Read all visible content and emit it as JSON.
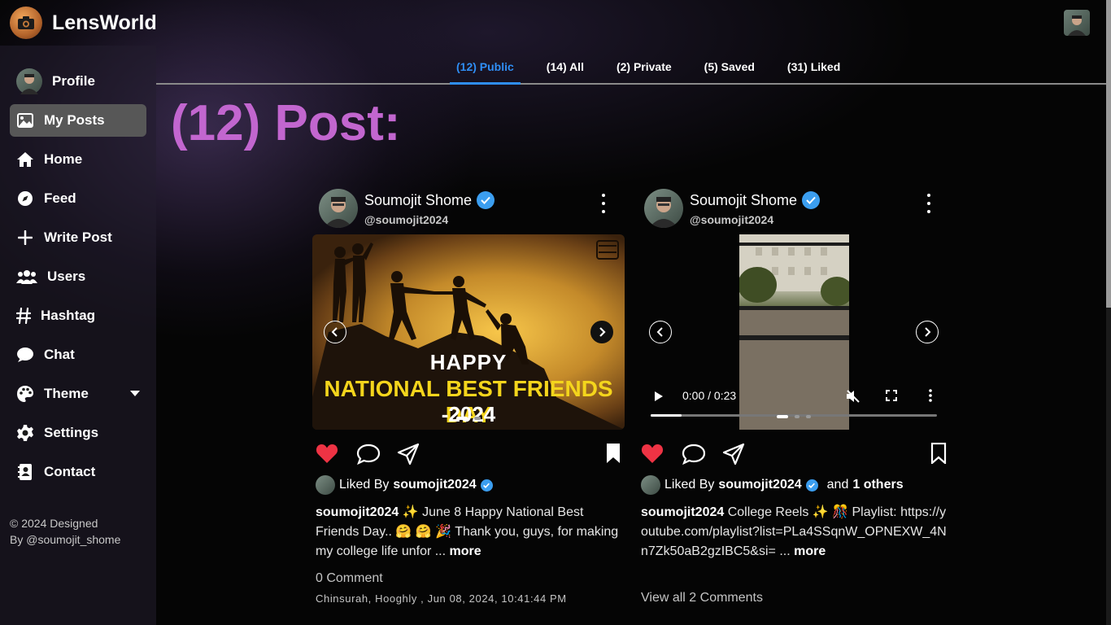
{
  "brand": {
    "name": "LensWorld"
  },
  "sidebar": {
    "items": [
      {
        "label": "Profile",
        "icon": "user-avatar"
      },
      {
        "label": "My Posts",
        "icon": "image-icon"
      },
      {
        "label": "Home",
        "icon": "home-icon"
      },
      {
        "label": "Feed",
        "icon": "compass-icon"
      },
      {
        "label": "Write Post",
        "icon": "plus-icon"
      },
      {
        "label": "Users",
        "icon": "users-icon"
      },
      {
        "label": "Hashtag",
        "icon": "hashtag-icon"
      },
      {
        "label": "Chat",
        "icon": "chat-icon"
      },
      {
        "label": "Theme",
        "icon": "palette-icon"
      },
      {
        "label": "Settings",
        "icon": "gear-icon"
      },
      {
        "label": "Contact",
        "icon": "contact-card-icon"
      }
    ],
    "footer_line1": "© 2024 Designed",
    "footer_line2": "By @soumojit_shome"
  },
  "tabs": [
    {
      "label": "(12) Public"
    },
    {
      "label": "(14) All"
    },
    {
      "label": "(2) Private"
    },
    {
      "label": "(5) Saved"
    },
    {
      "label": "(31) Liked"
    }
  ],
  "page_title": "(12) Post:",
  "colors": {
    "accent": "#2f8ef4",
    "heading": "#c266cf",
    "like": "#ee3344",
    "verified": "#3b9ef0"
  },
  "posts": [
    {
      "name": "Soumojit Shome",
      "handle": "@soumojit2024",
      "image_text": {
        "line1": "HAPPY",
        "line2": "NATIONAL BEST FRIENDS DAY",
        "line3": "-2024"
      },
      "liked_by_prefix": "Liked By",
      "liked_by_user": "soumojit2024",
      "caption_user": "soumojit2024",
      "caption_text": " ✨ June 8 Happy National Best Friends Day.. 🤗 🤗 🎉 Thank you, guys, for making my college life unfor ... ",
      "caption_more": "more",
      "comments": "0 Comment",
      "location_time": "Chinsurah, Hooghly , Jun 08, 2024, 10:41:44 PM"
    },
    {
      "name": "Soumojit Shome",
      "handle": "@soumojit2024",
      "video_time": "0:00 / 0:23",
      "video_progress": 0.108,
      "liked_by_prefix": "Liked By",
      "liked_by_user": "soumojit2024",
      "liked_by_suffix": "and",
      "liked_by_others": "1 others",
      "caption_user": "soumojit2024",
      "caption_text": " College Reels ✨ 🎊 Playlist: https://youtube.com/playlist?list=PLa4SSqnW_OPNEXW_4Nn7Zk50aB2gzIBC5&si= ... ",
      "caption_more": "more",
      "comments": "View all 2 Comments"
    }
  ]
}
